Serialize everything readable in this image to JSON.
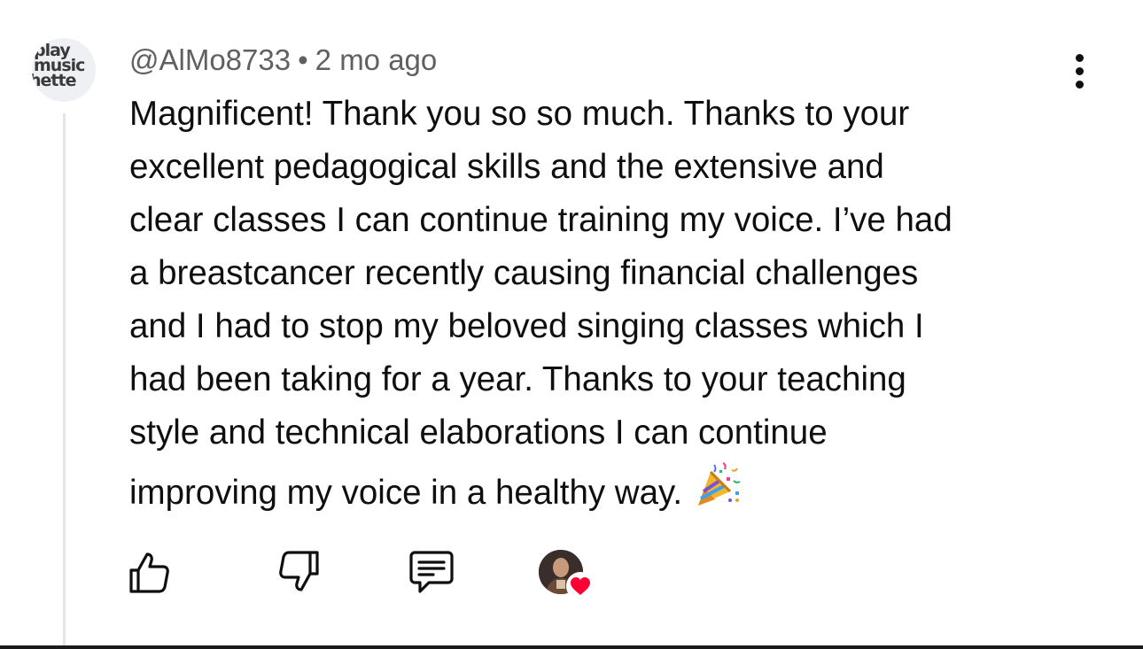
{
  "comment": {
    "channel_avatar_text": [
      "play",
      "music",
      "hette"
    ],
    "author": "@AlMo8733",
    "separator": "•",
    "timestamp": "2 mo ago",
    "text_lines": [
      "Magnificent! Thank you so so much. Thanks to your",
      "excellent pedagogical skills and the extensive and",
      "clear classes I can continue training my voice. I’ve had",
      "a breastcancer recently causing financial challenges",
      "and I had to stop my beloved singing classes which I",
      "had been taking for a year. Thanks to your teaching",
      "style and technical elaborations I can continue",
      "improving my voice in a healthy way."
    ],
    "emoji": "party-popper-icon"
  },
  "actions": {
    "like_icon": "thumbs-up-icon",
    "dislike_icon": "thumbs-down-icon",
    "reply_icon": "comment-bubble-icon",
    "creator_heart_icon": "creator-heart-badge-icon"
  },
  "colors": {
    "text": "#0f0f0f",
    "meta": "#606060",
    "thread_line": "#e5e5e5",
    "heart": "#ff0033"
  }
}
